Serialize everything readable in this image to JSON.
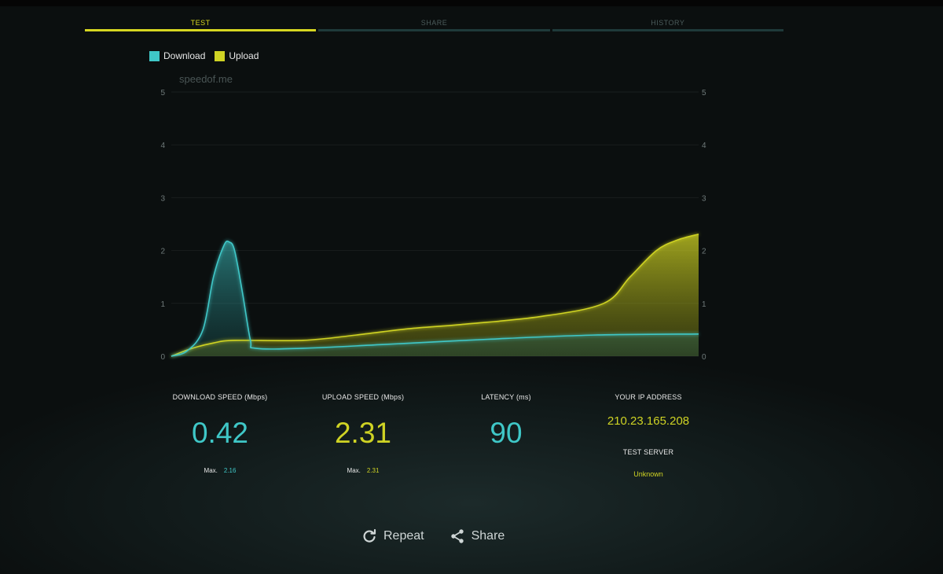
{
  "tabs": [
    {
      "label": "TEST",
      "active": true
    },
    {
      "label": "SHARE",
      "active": false
    },
    {
      "label": "HISTORY",
      "active": false
    }
  ],
  "legend": [
    {
      "label": "Download",
      "color": "#3fc7c7"
    },
    {
      "label": "Upload",
      "color": "#cfd324"
    }
  ],
  "watermark": "speedof.me",
  "chart_data": {
    "type": "area",
    "ylim": [
      0,
      5
    ],
    "yticks": [
      "0",
      "1",
      "2",
      "3",
      "4",
      "5"
    ],
    "grid": true,
    "legend_position": "top-left",
    "xlim": [
      0,
      100
    ],
    "series": [
      {
        "name": "Download",
        "color": "#3fc7c7",
        "points": [
          [
            0,
            0
          ],
          [
            3,
            0.1
          ],
          [
            6,
            0.5
          ],
          [
            8,
            1.5
          ],
          [
            10,
            2.1
          ],
          [
            11,
            2.16
          ],
          [
            12,
            2.0
          ],
          [
            13.5,
            1.2
          ],
          [
            15,
            0.3
          ],
          [
            16,
            0.15
          ],
          [
            25,
            0.15
          ],
          [
            40,
            0.22
          ],
          [
            60,
            0.32
          ],
          [
            80,
            0.4
          ],
          [
            100,
            0.42
          ]
        ]
      },
      {
        "name": "Upload",
        "color": "#cfd324",
        "points": [
          [
            0,
            0
          ],
          [
            4,
            0.15
          ],
          [
            8,
            0.25
          ],
          [
            12,
            0.3
          ],
          [
            25,
            0.3
          ],
          [
            35,
            0.4
          ],
          [
            45,
            0.52
          ],
          [
            55,
            0.6
          ],
          [
            70,
            0.75
          ],
          [
            82,
            1.0
          ],
          [
            87,
            1.5
          ],
          [
            92,
            2.0
          ],
          [
            96,
            2.2
          ],
          [
            100,
            2.31
          ]
        ]
      }
    ]
  },
  "stats": {
    "download": {
      "label": "DOWNLOAD SPEED (Mbps)",
      "value": "0.42",
      "max_label": "Max.",
      "max_value": "2.16"
    },
    "upload": {
      "label": "UPLOAD SPEED (Mbps)",
      "value": "2.31",
      "max_label": "Max.",
      "max_value": "2.31"
    },
    "latency": {
      "label": "LATENCY (ms)",
      "value": "90"
    },
    "ip": {
      "label": "YOUR IP ADDRESS",
      "value": "210.23.165.208"
    },
    "server": {
      "label": "TEST SERVER",
      "value": "Unknown"
    }
  },
  "actions": {
    "repeat": "Repeat",
    "share": "Share"
  },
  "icons": {
    "repeat": "refresh-icon",
    "share": "share-icon"
  }
}
